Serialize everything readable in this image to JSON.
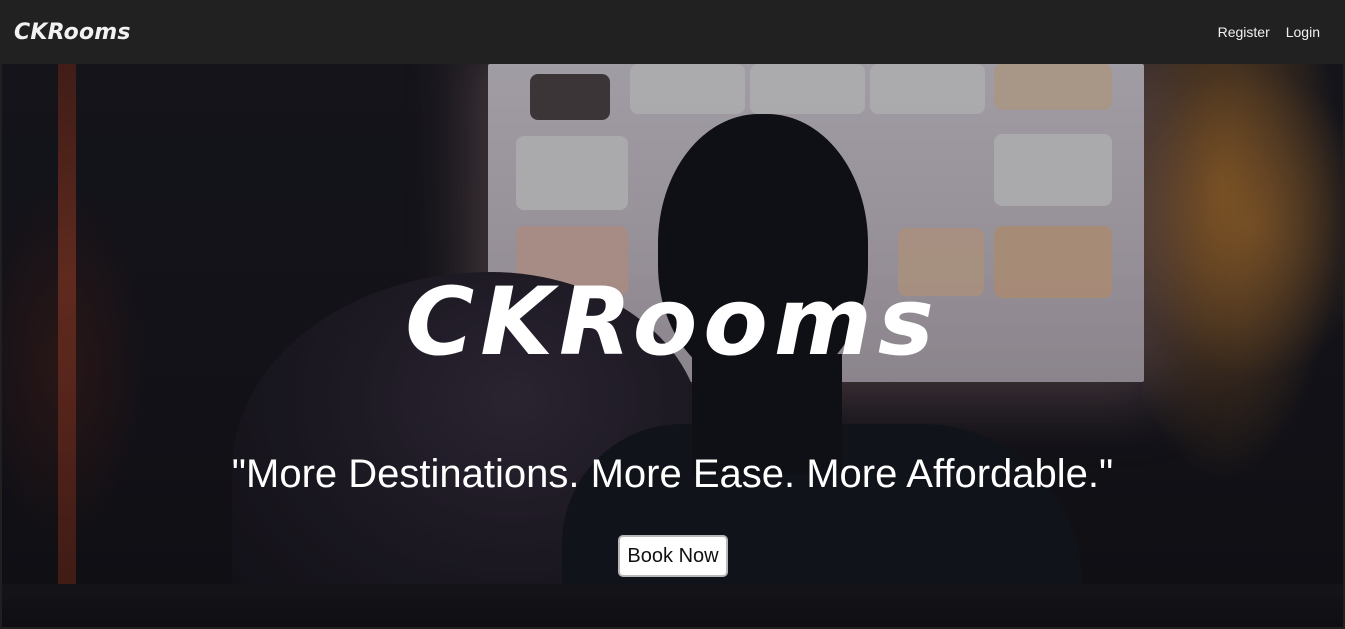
{
  "navbar": {
    "brand": "CKRooms",
    "links": [
      {
        "label": "Register"
      },
      {
        "label": "Login"
      }
    ]
  },
  "hero": {
    "title": "CKRooms",
    "tagline": "\"More Destinations. More Ease. More Affordable.\"",
    "cta_label": "Book Now",
    "background_image": "couple-watching-tv-photo"
  },
  "colors": {
    "navbar_bg": "#212121",
    "text": "#ffffff",
    "button_bg": "#ffffff",
    "button_border": "#b8b8b8"
  }
}
